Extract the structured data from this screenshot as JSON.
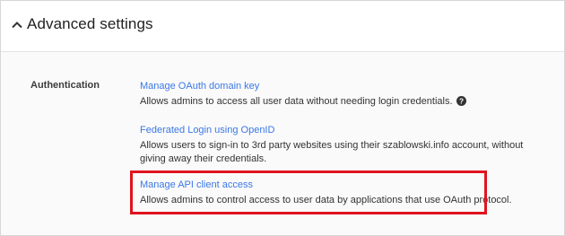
{
  "header": {
    "title": "Advanced settings",
    "toggle_icon": "chevron-up-icon"
  },
  "section": {
    "label": "Authentication"
  },
  "settings": [
    {
      "link": "Manage OAuth domain key",
      "description": "Allows admins to access all user data without needing login credentials.",
      "help_icon": "help-icon"
    },
    {
      "link": "Federated Login using OpenID",
      "description_line1": "Allows users to sign-in to 3rd party websites using their szablowski.info account, without",
      "description_line2": "giving away their credentials."
    },
    {
      "link": "Manage API client access",
      "description": "Allows admins to control access to user data by applications that use OAuth protocol."
    }
  ],
  "colors": {
    "link": "#3b78e7",
    "highlight": "#e0141e",
    "body_bg": "#fafafa"
  }
}
